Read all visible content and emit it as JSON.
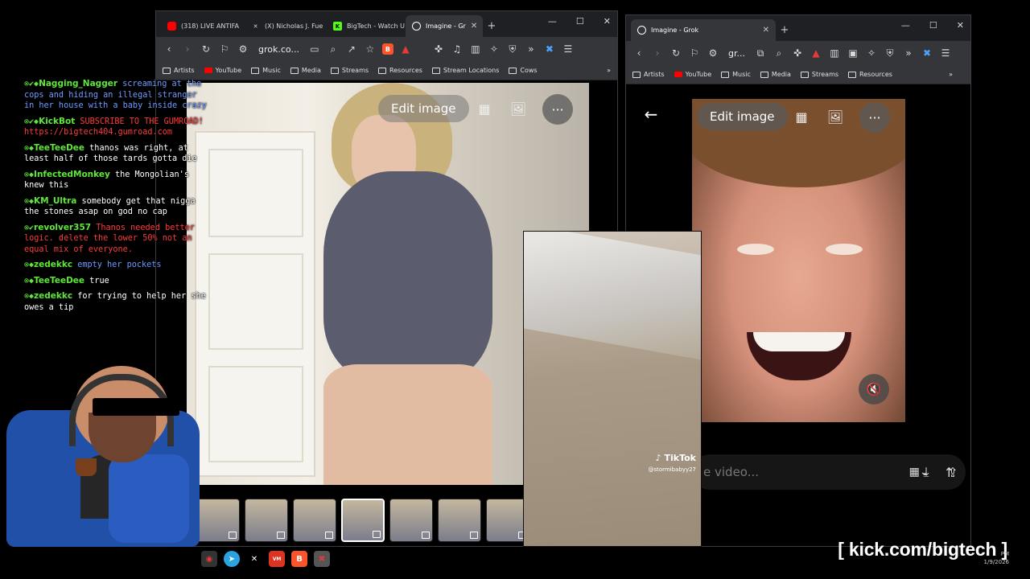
{
  "left_browser": {
    "tabs": [
      {
        "label": "(318) LIVE ANTIFA",
        "icon": "youtube-icon",
        "color": "#ff0000"
      },
      {
        "label": "(X) Nicholas J. Fue",
        "icon": "x-icon",
        "color": "#ffffff"
      },
      {
        "label": "BigTech - Watch U",
        "icon": "kick-icon",
        "color": "#53fc18"
      },
      {
        "label": "Imagine - Gr",
        "icon": "grok-icon",
        "color": "#ffffff"
      }
    ],
    "url": "grok.co...",
    "bookmarks": [
      "Artists",
      "YouTube",
      "Music",
      "Media",
      "Streams",
      "Resources",
      "Stream Locations",
      "Cows"
    ],
    "edit_image_label": "Edit image"
  },
  "right_browser": {
    "tabs": [
      {
        "label": "Imagine - Grok",
        "icon": "grok-icon"
      }
    ],
    "url": "gr...",
    "bookmarks": [
      "Artists",
      "YouTube",
      "Music",
      "Media",
      "Streams",
      "Resources"
    ],
    "edit_image_label": "Edit image",
    "prompt_placeholder": "e video..."
  },
  "tiktok": {
    "logo": "TikTok",
    "username": "@stormibabyy27"
  },
  "chat": [
    {
      "user": "Nagging_Nagger",
      "text": "screaming at the cops and hiding an illegal stranger in her house with a baby inside crazy",
      "style": "blue"
    },
    {
      "user": "KickBot",
      "text": "SUBSCRIBE TO THE GUMROAD! https://bigtech404.gumroad.com",
      "style": "red"
    },
    {
      "user": "TeeTeeDee",
      "text": "thanos was right, at least half of those tards gotta die",
      "style": "white"
    },
    {
      "user": "InfectedMonkey",
      "text": "the Mongolian's knew this",
      "style": "white"
    },
    {
      "user": "KM_Ultra",
      "text": "somebody get that nigga the stones asap on god no cap",
      "style": "white"
    },
    {
      "user": "revolver357",
      "text": "Thanos needed better logic. delete the lower 50% not an equal mix of everyone.",
      "style": "red"
    },
    {
      "user": "zedekkc",
      "text": "empty her pockets",
      "style": "blue"
    },
    {
      "user": "TeeTeeDee",
      "text": "true",
      "style": "white"
    },
    {
      "user": "zedekkc",
      "text": "for trying to help her she owes a tip",
      "style": "white"
    }
  ],
  "watermark": "[ kick.com/bigtech ]",
  "clock": {
    "time": "PM",
    "date": "1/9/2026"
  }
}
